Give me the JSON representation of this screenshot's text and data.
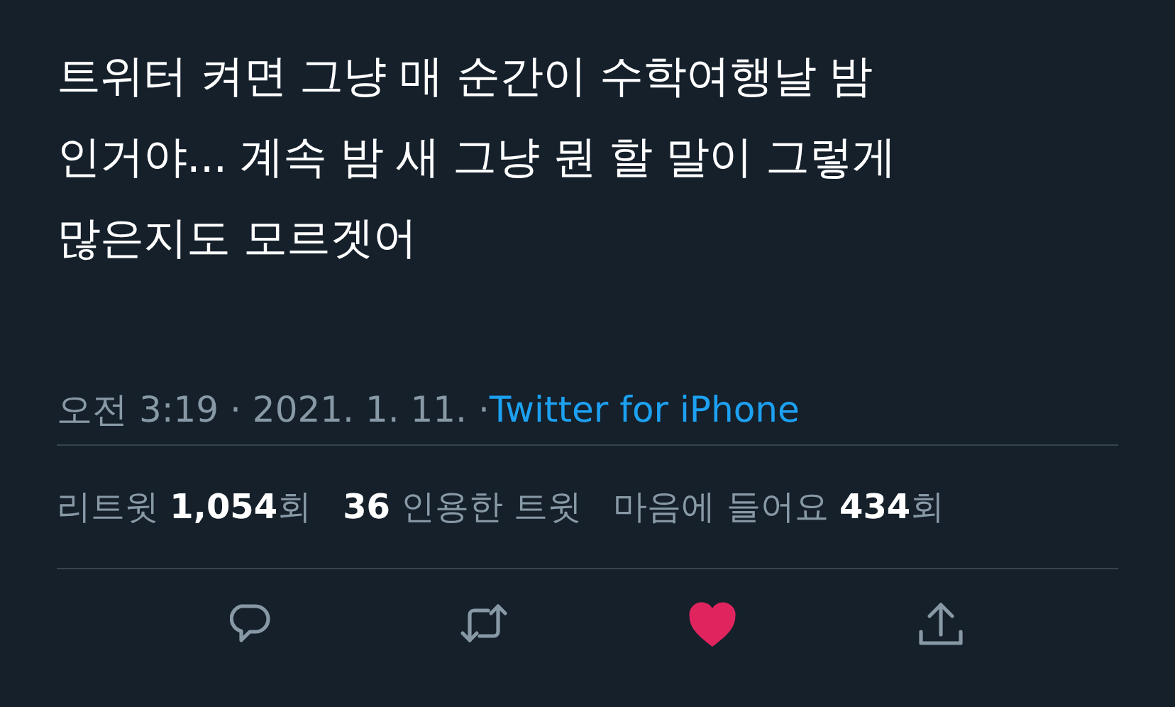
{
  "tweet": {
    "text": "트위터 켜면 그냥 매 순간이 수학여행날 밤\n인거야... 계속 밤 새 그냥 뭔 할 말이 그렇게\n많은지도 모르겟어",
    "time": "오전 3:19 · 2021. 1. 11. · ",
    "source": "Twitter for iPhone"
  },
  "stats": [
    "리트윗 **1,054**회",
    "**36** 인용한 트윗",
    "마음에 들어요 **434**회"
  ],
  "actions": [
    {
      "kind": "reply"
    },
    {
      "kind": "retweet"
    },
    {
      "kind": "like",
      "selected": true
    },
    {
      "kind": "share"
    }
  ]
}
